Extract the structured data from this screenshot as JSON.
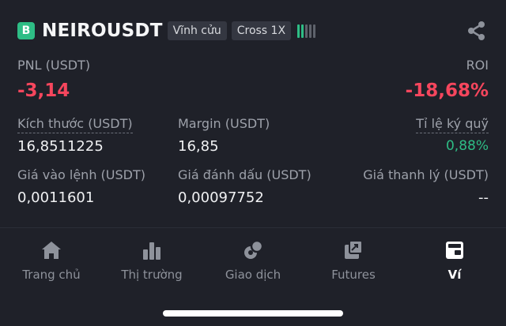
{
  "position": {
    "side_badge": "B",
    "symbol": "NEIROUSDT",
    "tags": [
      "Vĩnh cửu",
      "Cross 1X"
    ],
    "risk_bars_colors": [
      "#2ebd85",
      "#2ebd85",
      "#5e626b",
      "#5e626b",
      "#5e626b"
    ],
    "share_icon": "share-icon"
  },
  "pnl": {
    "label": "PNL (USDT)",
    "value": "-3,14"
  },
  "roi": {
    "label": "ROI",
    "value": "-18,68%"
  },
  "stats": {
    "size": {
      "label": "Kích thước (USDT)",
      "value": "16,8511225"
    },
    "margin": {
      "label": "Margin (USDT)",
      "value": "16,85"
    },
    "margin_ratio": {
      "label": "Tỉ lệ ký quỹ",
      "value": "0,88%"
    },
    "entry_price": {
      "label": "Giá vào lệnh (USDT)",
      "value": "0,0011601"
    },
    "mark_price": {
      "label": "Giá đánh dấu (USDT)",
      "value": "0,00097752"
    },
    "liq_price": {
      "label": "Giá thanh lý (USDT)",
      "value": "--"
    }
  },
  "nav": {
    "items": [
      {
        "label": "Trang chủ",
        "icon": "home-icon"
      },
      {
        "label": "Thị trường",
        "icon": "bar-chart-icon"
      },
      {
        "label": "Giao dịch",
        "icon": "trade-icon"
      },
      {
        "label": "Futures",
        "icon": "futures-icon"
      },
      {
        "label": "Ví",
        "icon": "wallet-icon"
      }
    ],
    "active": "Ví"
  },
  "colors": {
    "loss": "#f6465d",
    "gain": "#2ebd85",
    "background": "#1f2129"
  }
}
